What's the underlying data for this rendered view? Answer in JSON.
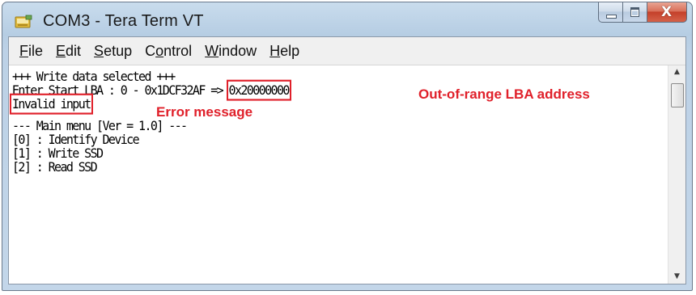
{
  "window": {
    "title": "COM3 - Tera Term VT",
    "icon": "tera-term-app-icon"
  },
  "caption_buttons": {
    "minimize_icon": "minimize-icon",
    "maximize_icon": "maximize-icon",
    "close_icon": "close-icon",
    "close_glyph": "X"
  },
  "menu": {
    "items": [
      {
        "mnemonic": "F",
        "rest": "ile"
      },
      {
        "mnemonic": "E",
        "rest": "dit"
      },
      {
        "mnemonic": "S",
        "rest": "etup"
      },
      {
        "pre": "C",
        "mnemonic": "o",
        "rest": "ntrol"
      },
      {
        "mnemonic": "W",
        "rest": "indow"
      },
      {
        "mnemonic": "H",
        "rest": "elp"
      }
    ]
  },
  "terminal": {
    "line1": "+++ Write data selected +++",
    "line2_prefix": "Enter Start LBA : 0 - 0x1DCF32AF => ",
    "line2_input": "0x20000000",
    "line3_error": "Invalid input",
    "line5": "--- Main menu [Ver = 1.0] ---",
    "line6": "[0] : Identify Device",
    "line7": "[1] : Write SSD",
    "line8": "[2] : Read SSD"
  },
  "annotations": {
    "input_note": "Out-of-range LBA address",
    "error_note": "Error message",
    "color": "#e0202a"
  },
  "scrollbar": {
    "up_icon": "scroll-up-arrow-icon",
    "down_icon": "scroll-down-arrow-icon"
  }
}
